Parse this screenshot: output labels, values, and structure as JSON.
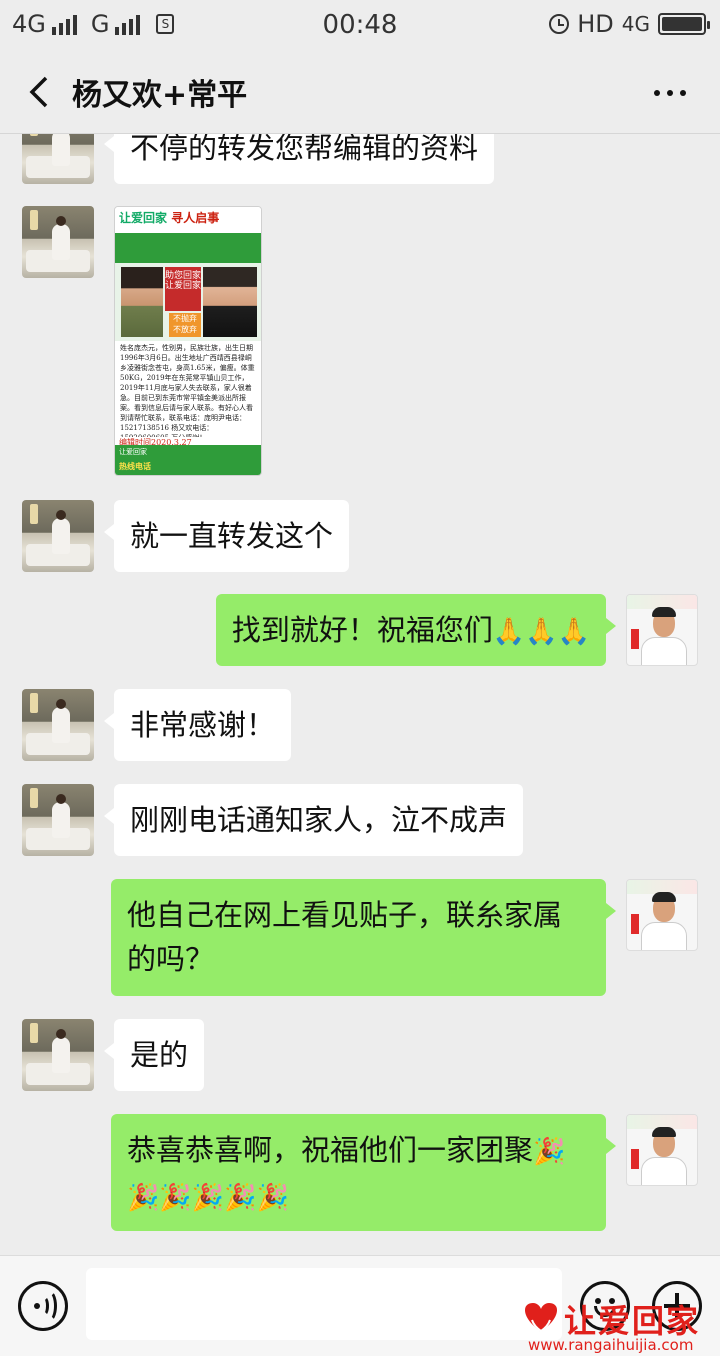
{
  "status_bar": {
    "network1": "4G",
    "network2": "G",
    "time": "00:48",
    "hd": "HD",
    "network3": "4G"
  },
  "nav": {
    "title": "杨又欢+常平"
  },
  "messages": [
    {
      "side": "in",
      "text": "不停的转发您帮编辑的资料"
    },
    {
      "side": "in",
      "type": "image"
    },
    {
      "side": "in",
      "text": "就一直转发这个"
    },
    {
      "side": "out",
      "text": "找到就好！祝福您们",
      "emoji": "🙏🙏🙏"
    },
    {
      "side": "in",
      "text": "非常感谢！"
    },
    {
      "side": "in",
      "text": "刚刚电话通知家人，泣不成声"
    },
    {
      "side": "out",
      "text": "他自己在网上看见贴子，联糸家属的吗？"
    },
    {
      "side": "in",
      "text": "是的"
    },
    {
      "side": "out",
      "text": "恭喜恭喜啊，祝福他们一家团聚",
      "emoji": "🎉",
      "emoji2": "🎉🎉🎉🎉🎉"
    }
  ],
  "poster": {
    "header": "让爱回家",
    "header2": "寻人启事",
    "tag": "助您回家 让爱回家",
    "tag2": "不抛弃 不放弃",
    "body": "姓名庞杰元，性别男，民族壮族，出生日期1996年3月6日。出生地址广西靖西县禄峒乡凌雅街念苍屯，身高1.65米，偏瘦。体重50KG，2019年在东莞常平镇山贝工作，2019年11月底与家人失去联系，家人很着急。目前已到东莞市常平镇金美派出所报案。看到信息后请与家人联系。有好心人看到请帮忙联系，联系电话：庞明尹电话：15217138516 杨又欢电话：15920600605 万分感谢！",
    "date": "编辑时间2020.3.27",
    "footer": "让爱回家",
    "hotline": "热线电话"
  },
  "input": {
    "placeholder": ""
  },
  "watermark": {
    "text": "让爱回家",
    "url": "www.rangaihuijia.com"
  },
  "colors": {
    "outgoing_bubble": "#95ec69",
    "incoming_bubble": "#ffffff",
    "background": "#ededed",
    "watermark": "#e0201b"
  }
}
